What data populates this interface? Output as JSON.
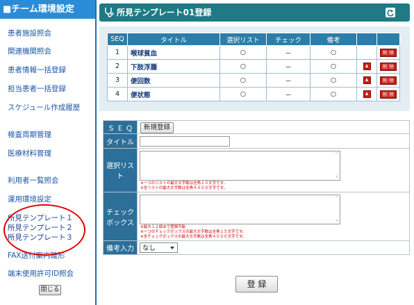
{
  "sidebar": {
    "header": "■チーム環境設定",
    "items": [
      "患者施設照会",
      "関連機関照会",
      "患者情報一括登録",
      "担当患者一括登録",
      "スケジュール作成履歴",
      "検査周期管理",
      "医療材料管理",
      "利用者一覧照会",
      "運用環境設定",
      "所見テンプレート１",
      "所見テンプレート２",
      "所見テンプレート３",
      "FAX送付案内雛形",
      "端末使用許可ID照会"
    ],
    "close_label": "閉じる"
  },
  "main": {
    "title": "所見テンプレート01登録",
    "table": {
      "headers": [
        "SEQ",
        "タイトル",
        "選択リスト",
        "チェック",
        "備考"
      ],
      "rows": [
        {
          "seq": "1",
          "title": "喉球貧血",
          "select": "○",
          "check": "－",
          "note": "○"
        },
        {
          "seq": "2",
          "title": "下肢浮腫",
          "select": "○",
          "check": "－",
          "note": "○"
        },
        {
          "seq": "3",
          "title": "便回数",
          "select": "○",
          "check": "－",
          "note": "○"
        },
        {
          "seq": "4",
          "title": "便状態",
          "select": "○",
          "check": "－",
          "note": "○"
        }
      ],
      "delete_label": "削 除"
    },
    "form": {
      "seq_label": "Ｓ Ｅ Ｑ",
      "new_button": "新規登録",
      "title_label": "タイトル",
      "select_label": "選択リスト",
      "select_note1": "※一つのリストの最大文字数は全角１５文字です。",
      "select_note2": "※全リストの最大文字数は全角４０００文字です。",
      "check_label1": "チェック",
      "check_label2": "ボックス",
      "check_note1": "※最大１２個まで登録可能",
      "check_note2": "※一つのチェックボックスの最大文字数は全角１５文字です。",
      "check_note3": "※全チェックボックスの最大文字数は全角４０００文字です。",
      "remark_label": "備考入力",
      "remark_value": "なし"
    },
    "register_label": "登 録"
  },
  "colors": {
    "sidebar_header": "#2a8cd6",
    "title_bar": "#1f7a86",
    "table_header": "#2c7da8",
    "highlight_circle": "#e00000"
  }
}
